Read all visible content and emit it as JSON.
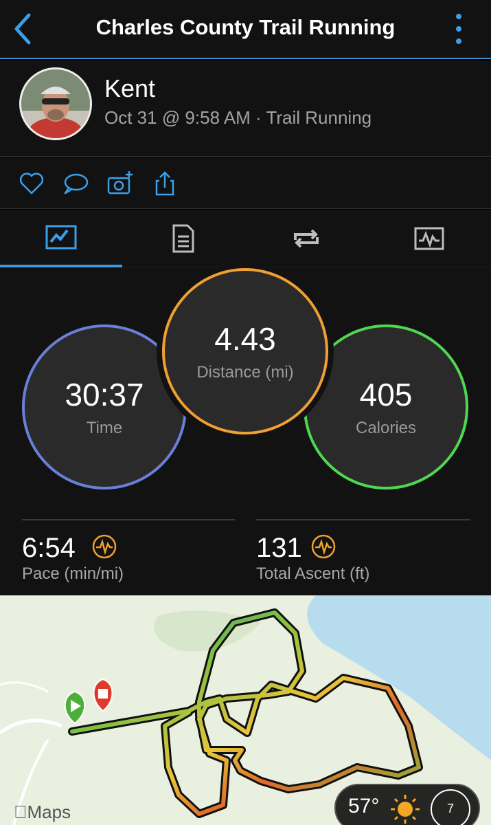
{
  "header": {
    "title": "Charles County Trail Running"
  },
  "activity": {
    "user_name": "Kent",
    "meta": "Oct 31 @ 9:58 AM · Trail Running"
  },
  "actions": [
    "heart-icon",
    "comment-icon",
    "add-photo-icon",
    "share-icon"
  ],
  "tabs": [
    "overview",
    "details",
    "laps",
    "charts"
  ],
  "stats": {
    "time": {
      "value": "30:37",
      "label": "Time"
    },
    "distance": {
      "value": "4.43",
      "label": "Distance (mi)"
    },
    "calories": {
      "value": "405",
      "label": "Calories"
    },
    "pace": {
      "value": "6:54",
      "label": "Pace (min/mi)"
    },
    "ascent": {
      "value": "131",
      "label": "Total Ascent (ft)"
    }
  },
  "map": {
    "attribution": "Maps",
    "temperature": "57°",
    "wind_speed": "7"
  },
  "colors": {
    "accent": "#3a9be8",
    "distance_ring": "#f0a030",
    "calories_ring": "#4fd84f"
  }
}
